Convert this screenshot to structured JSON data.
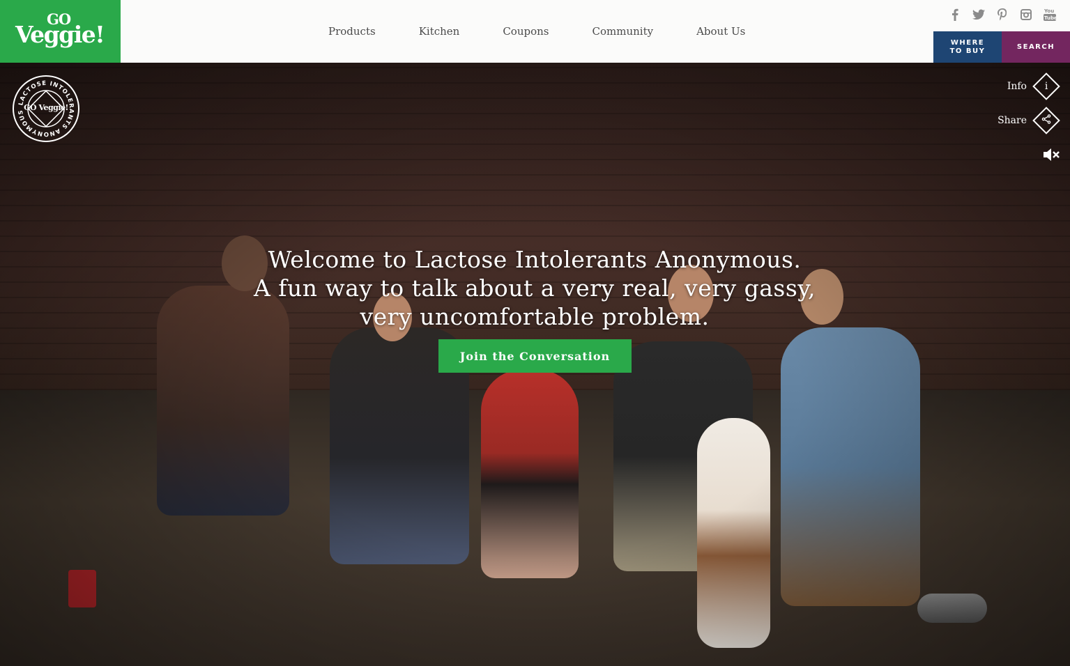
{
  "brand": {
    "logo_go": "GO",
    "logo_main": "Veggie!",
    "green": "#2aa94a"
  },
  "nav": {
    "items": [
      "Products",
      "Kitchen",
      "Coupons",
      "Community",
      "About Us"
    ]
  },
  "social": [
    {
      "name": "facebook-icon",
      "glyph": "f"
    },
    {
      "name": "twitter-icon",
      "glyph": "t"
    },
    {
      "name": "pinterest-icon",
      "glyph": "P"
    },
    {
      "name": "instagram-icon",
      "glyph": "◙"
    },
    {
      "name": "youtube-icon",
      "glyph": "▶"
    }
  ],
  "header_buttons": {
    "where_to_buy": "WHERE TO BUY",
    "search": "SEARCH",
    "where_color": "#1e4573",
    "search_color": "#73265f"
  },
  "badge": {
    "center": "GO Veggie!",
    "ring": "LACTOSE INTOLERANTS ANONYMOUS"
  },
  "side_controls": {
    "info_label": "Info",
    "info_icon": "i",
    "share_label": "Share",
    "mute_icon": "volume-mute-icon"
  },
  "hero": {
    "line1": "Welcome to Lactose Intolerants Anonymous.",
    "line2": "A fun way to talk about a very real, very gassy,",
    "line3": "very uncomfortable problem.",
    "cta_label": "Join the Conversation"
  }
}
